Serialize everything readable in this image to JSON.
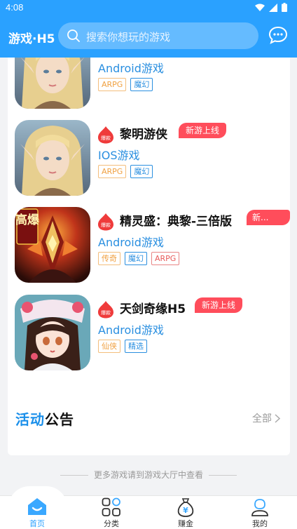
{
  "status_bar": {
    "time": "4:08"
  },
  "header": {
    "title": "游戏·H5",
    "search_placeholder": "搜索你想玩的游戏"
  },
  "hot_label": "爆款",
  "games": [
    {
      "name": "",
      "badge": "",
      "platform": "Android游戏",
      "tags": [
        {
          "text": "ARPG",
          "color": "orange"
        },
        {
          "text": "魔幻",
          "color": "blue"
        }
      ]
    },
    {
      "name": "黎明游侠",
      "badge": "新游上线",
      "platform": "IOS游戏",
      "tags": [
        {
          "text": "ARPG",
          "color": "orange"
        },
        {
          "text": "魔幻",
          "color": "blue"
        }
      ]
    },
    {
      "name": "精灵盛：典黎-三倍版",
      "badge": "新...",
      "platform": "Android游戏",
      "tags": [
        {
          "text": "传奇",
          "color": "orange"
        },
        {
          "text": "魔幻",
          "color": "blue"
        },
        {
          "text": "ARPG",
          "color": "red"
        }
      ]
    },
    {
      "name": "天剑奇缘H5",
      "badge": "新游上线",
      "platform": "Android游戏",
      "tags": [
        {
          "text": "仙侠",
          "color": "orange"
        },
        {
          "text": "精选",
          "color": "blue"
        }
      ]
    }
  ],
  "game3_badge_art": "高爆",
  "notice": {
    "title_part1": "活动",
    "title_part2": "公告",
    "all_label": "全部"
  },
  "more_text": "更多游戏请到游戏大厅中查看",
  "tabs": [
    {
      "label": "首页"
    },
    {
      "label": "分类"
    },
    {
      "label": "赚金"
    },
    {
      "label": "我的"
    }
  ],
  "colors": {
    "primary": "#2aa1ff",
    "badge": "#ff4d5b",
    "platform_text": "#2a8fe0"
  }
}
